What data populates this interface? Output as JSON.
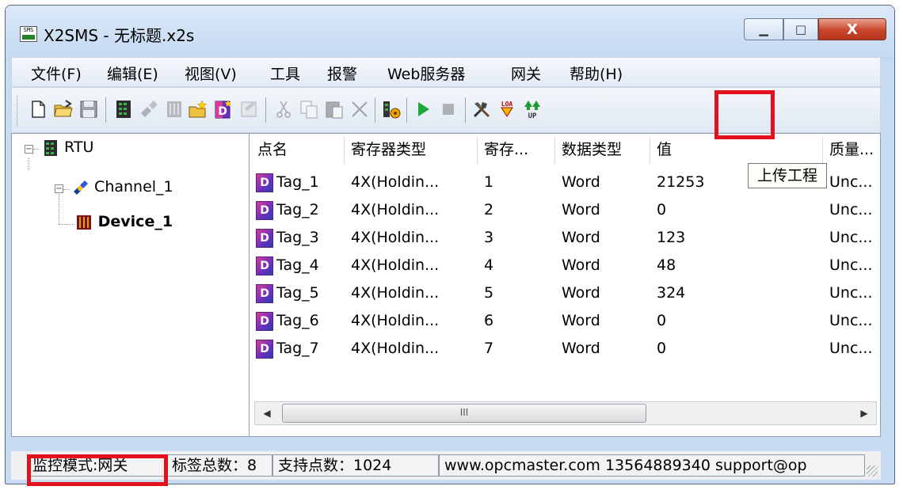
{
  "window": {
    "title": "X2SMS - 无标题.x2s",
    "app_icon_text": "SMS",
    "min_glyph": "▁",
    "max_glyph": "□",
    "close_glyph": "X"
  },
  "menu": {
    "items": [
      "文件(F)",
      "编辑(E)",
      "视图(V)",
      "工具",
      "报警",
      "Web服务器",
      "网关",
      "帮助(H)"
    ]
  },
  "toolbar": {
    "icons": [
      "new-file-icon",
      "open-folder-icon",
      "save-icon",
      "add-rtu-icon",
      "add-channel-icon",
      "add-device-icon",
      "new-device-wizard-icon",
      "add-tag-icon",
      "properties-icon",
      "cut-icon",
      "copy-icon",
      "paste-icon",
      "delete-icon",
      "monitor-icon",
      "run-icon",
      "stop-icon",
      "tools-icon",
      "download-project-icon",
      "upload-project-icon"
    ],
    "load_label": "LOA",
    "up_label": "UP",
    "tooltip": "上传工程"
  },
  "tree": {
    "root": "RTU",
    "channel": "Channel_1",
    "device": "Device_1"
  },
  "table": {
    "columns": [
      "点名",
      "寄存器类型",
      "寄存...",
      "数据类型",
      "值",
      "质量..."
    ],
    "rows": [
      {
        "name": "Tag_1",
        "register_type": "4X(Holdin...",
        "address": "1",
        "data_type": "Word",
        "value": "21253",
        "quality": "Unc..."
      },
      {
        "name": "Tag_2",
        "register_type": "4X(Holdin...",
        "address": "2",
        "data_type": "Word",
        "value": "0",
        "quality": "Unc..."
      },
      {
        "name": "Tag_3",
        "register_type": "4X(Holdin...",
        "address": "3",
        "data_type": "Word",
        "value": "123",
        "quality": "Unc..."
      },
      {
        "name": "Tag_4",
        "register_type": "4X(Holdin...",
        "address": "4",
        "data_type": "Word",
        "value": "48",
        "quality": "Unc..."
      },
      {
        "name": "Tag_5",
        "register_type": "4X(Holdin...",
        "address": "5",
        "data_type": "Word",
        "value": "324",
        "quality": "Unc..."
      },
      {
        "name": "Tag_6",
        "register_type": "4X(Holdin...",
        "address": "6",
        "data_type": "Word",
        "value": "0",
        "quality": "Unc..."
      },
      {
        "name": "Tag_7",
        "register_type": "4X(Holdin...",
        "address": "7",
        "data_type": "Word",
        "value": "0",
        "quality": "Unc..."
      }
    ],
    "scroll_thumb_glyph": "III"
  },
  "status": {
    "mode": "监控模式:网关",
    "tag_count": "标签总数：8",
    "supported_points": "支持点数：1024",
    "contact": "www.opcmaster.com 13564889340 support@op"
  },
  "colors": {
    "highlight_box": "#e3101e",
    "tag_icon": "#6b2fbf"
  }
}
